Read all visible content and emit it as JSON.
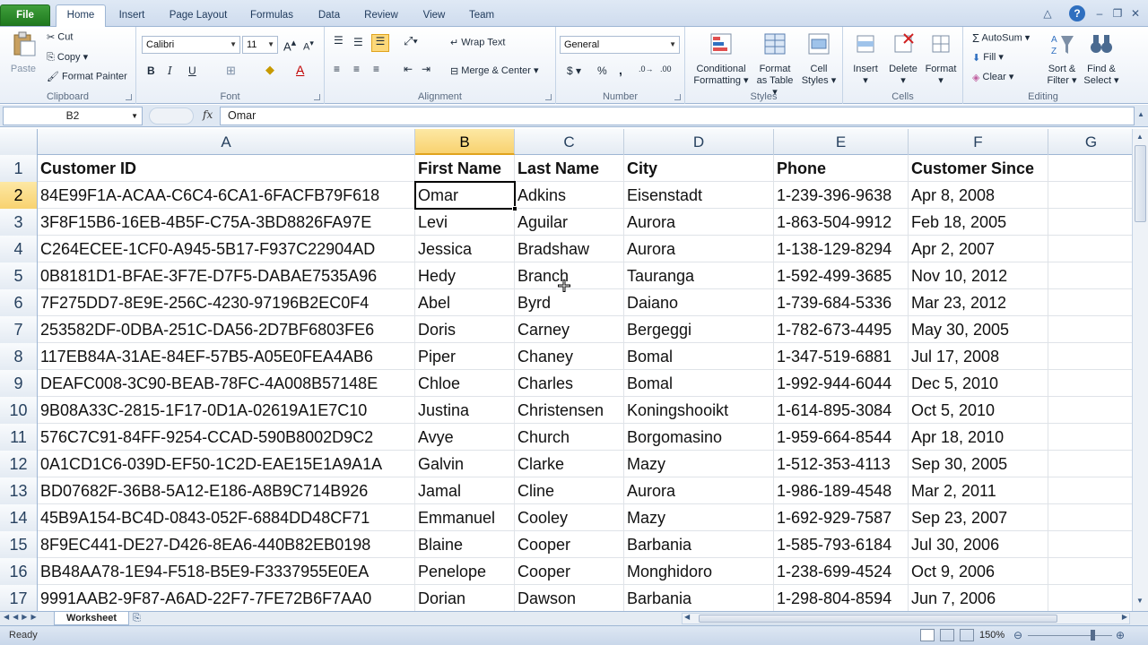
{
  "ribbon_tabs": [
    "File",
    "Home",
    "Insert",
    "Page Layout",
    "Formulas",
    "Data",
    "Review",
    "View",
    "Team"
  ],
  "clipboard": {
    "paste": "Paste",
    "cut": "Cut",
    "copy": "Copy",
    "format_painter": "Format Painter",
    "label": "Clipboard"
  },
  "font": {
    "name": "Calibri",
    "size": "11",
    "label": "Font",
    "bold": "B",
    "italic": "I",
    "underline": "U"
  },
  "alignment": {
    "wrap_text": "Wrap Text",
    "merge_center": "Merge & Center",
    "label": "Alignment"
  },
  "number": {
    "format": "General",
    "currency": "$",
    "percent": "%",
    "comma": ",",
    "label": "Number"
  },
  "styles": {
    "conditional": "Conditional",
    "conditional2": "Formatting",
    "format_table": "Format",
    "format_table2": "as Table",
    "cell_styles": "Cell",
    "cell_styles2": "Styles",
    "label": "Styles"
  },
  "cells": {
    "insert": "Insert",
    "delete": "Delete",
    "format": "Format",
    "label": "Cells"
  },
  "editing": {
    "autosum": "AutoSum",
    "fill": "Fill",
    "clear": "Clear",
    "sort": "Sort &",
    "sort2": "Filter",
    "find": "Find &",
    "find2": "Select",
    "label": "Editing"
  },
  "formula_bar": {
    "name_box": "B2",
    "fx": "fx",
    "value": "Omar"
  },
  "columns": [
    "A",
    "B",
    "C",
    "D",
    "E",
    "F",
    "G"
  ],
  "row_numbers": [
    "1",
    "2",
    "3",
    "4",
    "5",
    "6",
    "7",
    "8",
    "9",
    "10",
    "11",
    "12",
    "13",
    "14",
    "15",
    "16",
    "17"
  ],
  "header_row": [
    "Customer ID",
    "First Name",
    "Last Name",
    "City",
    "Phone",
    "Customer Since"
  ],
  "rows": [
    [
      "84E99F1A-ACAA-C6C4-6CA1-6FACFB79F618",
      "Omar",
      "Adkins",
      "Eisenstadt",
      "1-239-396-9638",
      "Apr 8, 2008"
    ],
    [
      "3F8F15B6-16EB-4B5F-C75A-3BD8826FA97E",
      "Levi",
      "Aguilar",
      "Aurora",
      "1-863-504-9912",
      "Feb 18, 2005"
    ],
    [
      "C264ECEE-1CF0-A945-5B17-F937C22904AD",
      "Jessica",
      "Bradshaw",
      "Aurora",
      "1-138-129-8294",
      "Apr 2, 2007"
    ],
    [
      "0B8181D1-BFAE-3F7E-D7F5-DABAE7535A96",
      "Hedy",
      "Branch",
      "Tauranga",
      "1-592-499-3685",
      "Nov 10, 2012"
    ],
    [
      "7F275DD7-8E9E-256C-4230-97196B2EC0F4",
      "Abel",
      "Byrd",
      "Daiano",
      "1-739-684-5336",
      "Mar 23, 2012"
    ],
    [
      "253582DF-0DBA-251C-DA56-2D7BF6803FE6",
      "Doris",
      "Carney",
      "Bergeggi",
      "1-782-673-4495",
      "May 30, 2005"
    ],
    [
      "117EB84A-31AE-84EF-57B5-A05E0FEA4AB6",
      "Piper",
      "Chaney",
      "Bomal",
      "1-347-519-6881",
      "Jul 17, 2008"
    ],
    [
      "DEAFC008-3C90-BEAB-78FC-4A008B57148E",
      "Chloe",
      "Charles",
      "Bomal",
      "1-992-944-6044",
      "Dec 5, 2010"
    ],
    [
      "9B08A33C-2815-1F17-0D1A-02619A1E7C10",
      "Justina",
      "Christensen",
      "Koningshooikt",
      "1-614-895-3084",
      "Oct 5, 2010"
    ],
    [
      "576C7C91-84FF-9254-CCAD-590B8002D9C2",
      "Avye",
      "Church",
      "Borgomasino",
      "1-959-664-8544",
      "Apr 18, 2010"
    ],
    [
      "0A1CD1C6-039D-EF50-1C2D-EAE15E1A9A1A",
      "Galvin",
      "Clarke",
      "Mazy",
      "1-512-353-4113",
      "Sep 30, 2005"
    ],
    [
      "BD07682F-36B8-5A12-E186-A8B9C714B926",
      "Jamal",
      "Cline",
      "Aurora",
      "1-986-189-4548",
      "Mar 2, 2011"
    ],
    [
      "45B9A154-BC4D-0843-052F-6884DD48CF71",
      "Emmanuel",
      "Cooley",
      "Mazy",
      "1-692-929-7587",
      "Sep 23, 2007"
    ],
    [
      "8F9EC441-DE27-D426-8EA6-440B82EB0198",
      "Blaine",
      "Cooper",
      "Barbania",
      "1-585-793-6184",
      "Jul 30, 2006"
    ],
    [
      "BB48AA78-1E94-F518-B5E9-F3337955E0EA",
      "Penelope",
      "Cooper",
      "Monghidoro",
      "1-238-699-4524",
      "Oct 9, 2006"
    ],
    [
      "9991AAB2-9F87-A6AD-22F7-7FE72B6F7AA0",
      "Dorian",
      "Dawson",
      "Barbania",
      "1-298-804-8594",
      "Jun 7, 2006"
    ]
  ],
  "sheet_tab": "Worksheet",
  "status": {
    "ready": "Ready",
    "zoom": "150%"
  },
  "colors": {
    "accent": "#1f7a1f",
    "selection": "#f8d270",
    "chrome": "#dfe8f3"
  }
}
